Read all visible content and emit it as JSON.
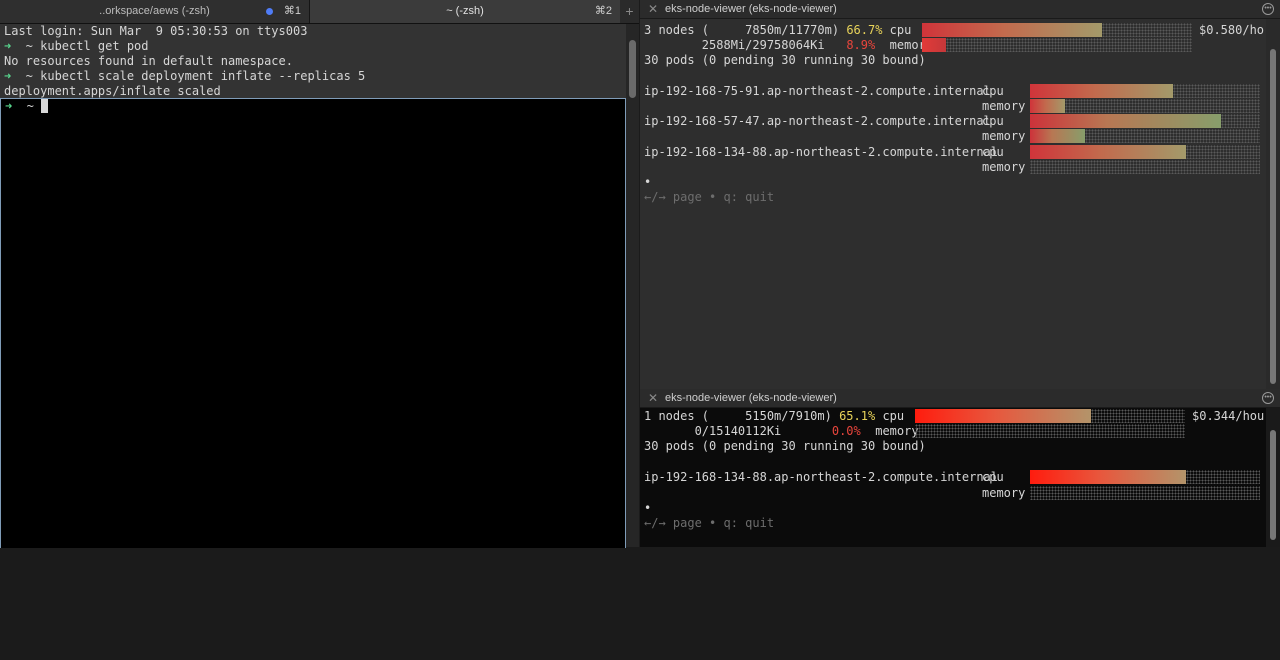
{
  "left_window": {
    "tabs": [
      {
        "label": "..orkspace/aews (-zsh)",
        "shortcut": "⌘1"
      },
      {
        "label": "~ (-zsh)",
        "shortcut": "⌘2"
      }
    ],
    "new_tab": "+",
    "lines": [
      {
        "text": "Last login: Sun Mar  9 05:30:53 on ttys003"
      },
      {
        "prompt": "➜",
        "text": "  ~ kubectl get pod"
      },
      {
        "text": "No resources found in default namespace."
      },
      {
        "prompt": "➜",
        "text": "  ~ kubectl scale deployment inflate --replicas 5"
      },
      {
        "text": "deployment.apps/inflate scaled"
      },
      {
        "prompt": "➜",
        "text": "  ~ "
      }
    ]
  },
  "top_pane": {
    "title": "eks-node-viewer (eks-node-viewer)",
    "summary": {
      "nodes_prefix": "3 nodes (     7850m/11770m)",
      "cpu_pct": "66.7%",
      "cpu_label": "cpu",
      "cpu_fraction": 0.667,
      "price": "$0.580/ho",
      "mem_prefix": "        2588Mi/29758064Ki",
      "mem_pct": "8.9%",
      "mem_label": "memory",
      "mem_fraction": 0.089,
      "pods": "30 pods (0 pending 30 running 30 bound)"
    },
    "nodes": [
      {
        "name": "ip-192-168-75-91.ap-northeast-2.compute.internal",
        "cpu_label": "cpu",
        "mem_label": "memory",
        "cpu_fraction": 0.62,
        "mem_fraction": 0.15
      },
      {
        "name": "ip-192-168-57-47.ap-northeast-2.compute.internal",
        "cpu_label": "cpu",
        "mem_label": "memory",
        "cpu_fraction": 0.83,
        "mem_fraction": 0.24
      },
      {
        "name": "ip-192-168-134-88.ap-northeast-2.compute.internal",
        "cpu_label": "cpu",
        "mem_label": "memory",
        "cpu_fraction": 0.68,
        "mem_fraction": 0.0
      }
    ],
    "bullet": "•",
    "footer": "←/→ page • q: quit"
  },
  "bottom_pane": {
    "title": "eks-node-viewer (eks-node-viewer)",
    "summary": {
      "nodes_prefix": "1 nodes (     5150m/7910m)",
      "cpu_pct": "65.1%",
      "cpu_label": "cpu",
      "cpu_fraction": 0.651,
      "price": "$0.344/hou",
      "mem_prefix": "       0/15140112Ki",
      "mem_pct": "0.0%",
      "mem_label": "memory",
      "mem_fraction": 0.0,
      "pods": "30 pods (0 pending 30 running 30 bound)"
    },
    "nodes": [
      {
        "name": "ip-192-168-134-88.ap-northeast-2.compute.internal",
        "cpu_label": "cpu",
        "mem_label": "memory",
        "cpu_fraction": 0.68,
        "mem_fraction": 0.0
      }
    ],
    "bullet": "•",
    "footer": "←/→ page • q: quit"
  },
  "colors": {
    "prompt": "#58d68d",
    "cpu_pct": "#e8d35a",
    "mem_pct": "#e8453c",
    "active_border": "#7f9cb8",
    "tab_dot": "#4f7cf6"
  }
}
